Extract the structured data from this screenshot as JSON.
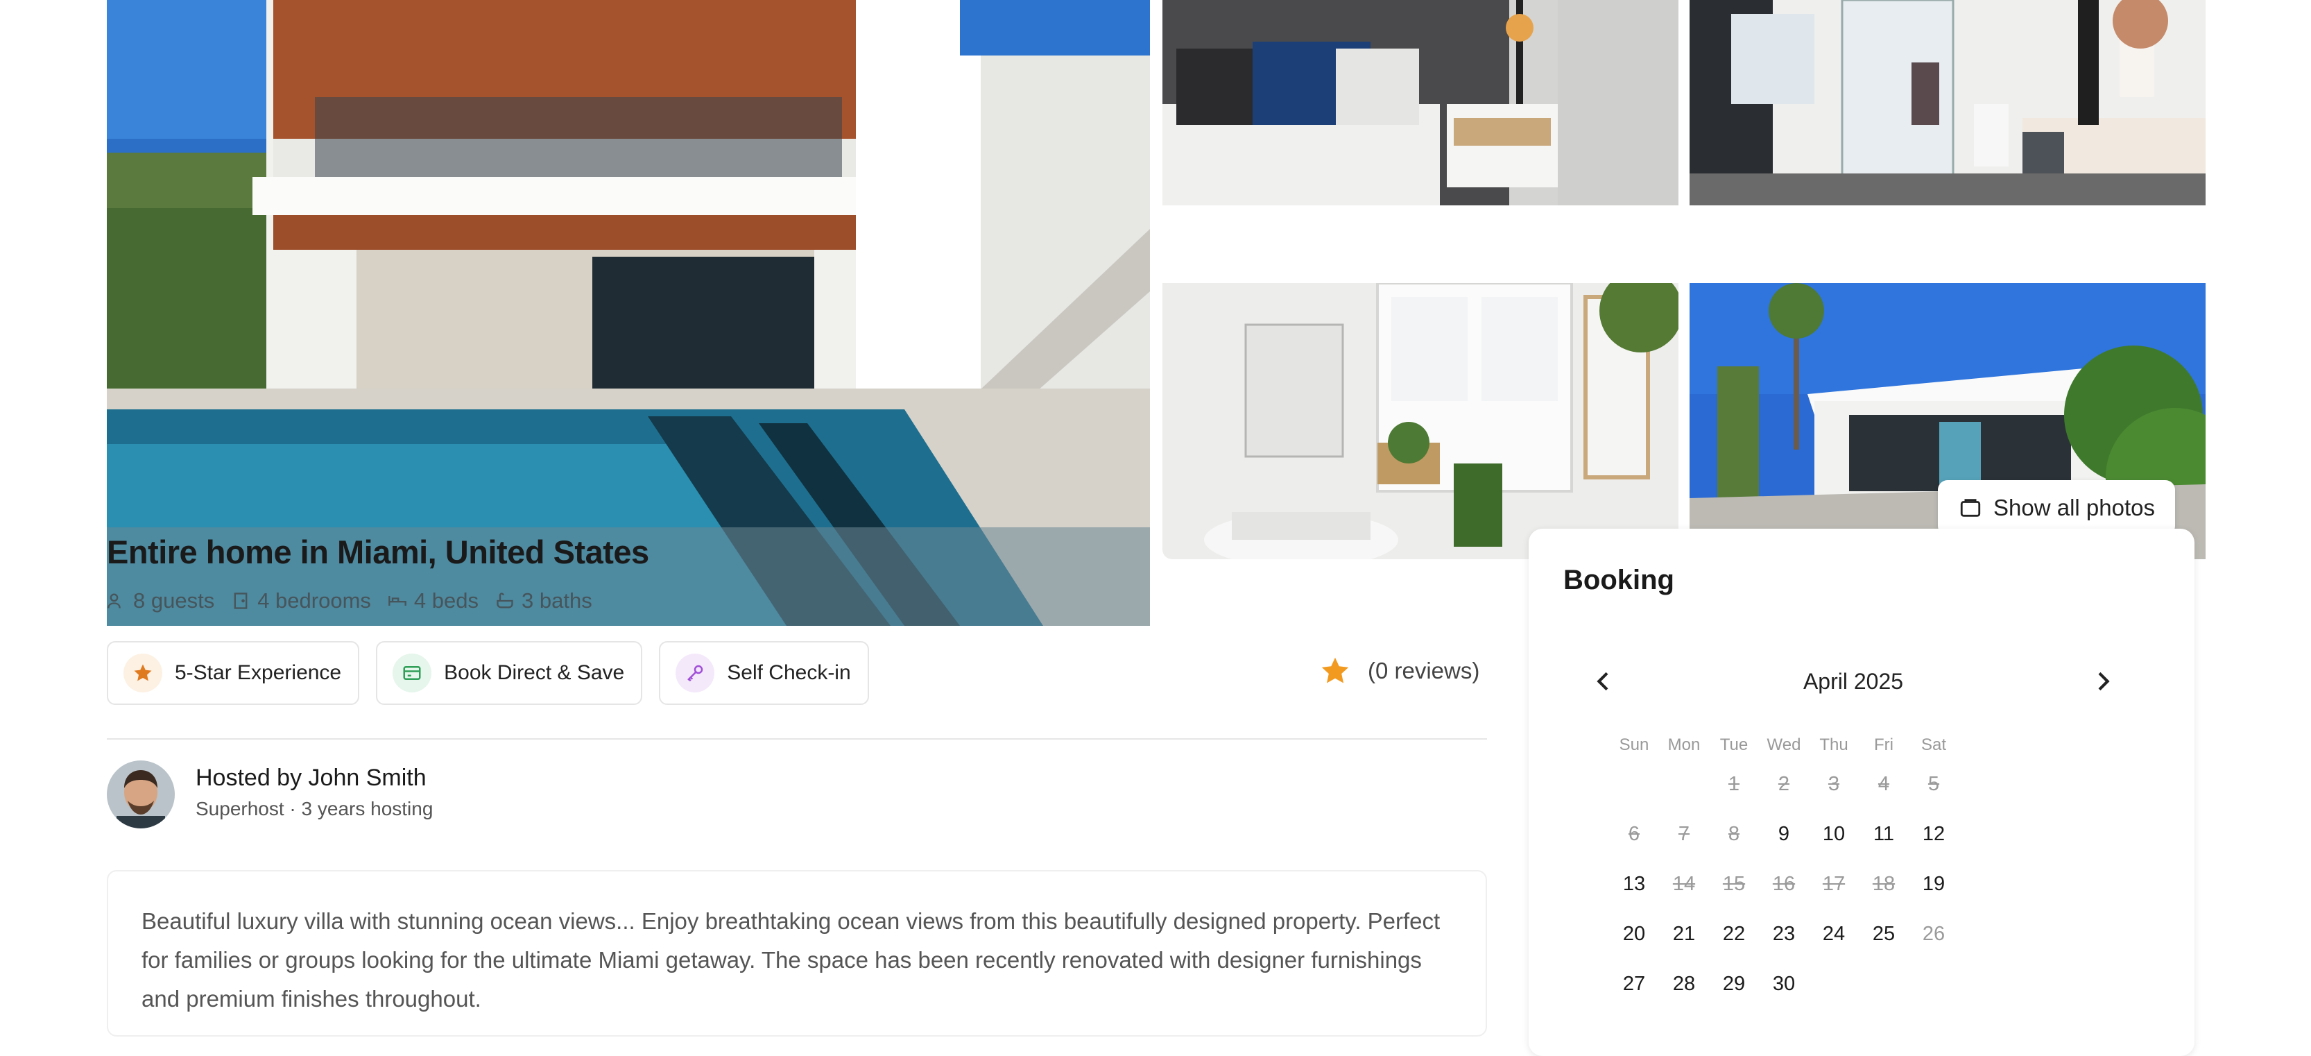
{
  "gallery": {
    "show_all_label": "Show all photos"
  },
  "listing": {
    "title": "Entire home in Miami, United States",
    "meta": [
      {
        "icon": "guests-icon",
        "label": "8 guests"
      },
      {
        "icon": "bedroom-icon",
        "label": "4 bedrooms"
      },
      {
        "icon": "bed-icon",
        "label": "4 beds"
      },
      {
        "icon": "bath-icon",
        "label": "3 baths"
      }
    ],
    "badges": [
      {
        "icon": "star-icon",
        "label": "5-Star Experience",
        "color": "#e07a1f",
        "bg": "#fdf1e4"
      },
      {
        "icon": "card-icon",
        "label": "Book Direct & Save",
        "color": "#2f9e57",
        "bg": "#e6f6ec"
      },
      {
        "icon": "key-icon",
        "label": "Self Check-in",
        "color": "#a04fd6",
        "bg": "#f4e9fb"
      }
    ],
    "rating": {
      "reviews_label": "(0 reviews)",
      "star_color": "#f29a1f"
    }
  },
  "host": {
    "name_label": "Hosted by John Smith",
    "subtitle": "Superhost · 3 years hosting"
  },
  "description": {
    "text": "Beautiful luxury villa with stunning ocean views... Enjoy breathtaking ocean views from this beautifully designed property. Perfect for families or groups looking for the ultimate Miami getaway. The space has been recently renovated with designer furnishings and premium finishes throughout."
  },
  "booking": {
    "title": "Booking",
    "month_label": "April 2025",
    "weekdays": [
      "Sun",
      "Mon",
      "Tue",
      "Wed",
      "Thu",
      "Fri",
      "Sat"
    ],
    "weeks": [
      [
        null,
        null,
        {
          "d": "1",
          "s": "past"
        },
        {
          "d": "2",
          "s": "past"
        },
        {
          "d": "3",
          "s": "past"
        },
        {
          "d": "4",
          "s": "past"
        },
        {
          "d": "5",
          "s": "past"
        }
      ],
      [
        {
          "d": "6",
          "s": "past"
        },
        {
          "d": "7",
          "s": "past"
        },
        {
          "d": "8",
          "s": "past"
        },
        {
          "d": "9",
          "s": "open"
        },
        {
          "d": "10",
          "s": "open"
        },
        {
          "d": "11",
          "s": "open"
        },
        {
          "d": "12",
          "s": "open"
        }
      ],
      [
        {
          "d": "13",
          "s": "open"
        },
        {
          "d": "14",
          "s": "past"
        },
        {
          "d": "15",
          "s": "past"
        },
        {
          "d": "16",
          "s": "past"
        },
        {
          "d": "17",
          "s": "past"
        },
        {
          "d": "18",
          "s": "past"
        },
        {
          "d": "19",
          "s": "open"
        }
      ],
      [
        {
          "d": "20",
          "s": "open"
        },
        {
          "d": "21",
          "s": "open"
        },
        {
          "d": "22",
          "s": "open"
        },
        {
          "d": "23",
          "s": "open"
        },
        {
          "d": "24",
          "s": "open"
        },
        {
          "d": "25",
          "s": "open"
        },
        {
          "d": "26",
          "s": "blocked"
        }
      ],
      [
        {
          "d": "27",
          "s": "open"
        },
        {
          "d": "28",
          "s": "open"
        },
        {
          "d": "29",
          "s": "open"
        },
        {
          "d": "30",
          "s": "open"
        },
        null,
        null,
        null
      ]
    ]
  }
}
